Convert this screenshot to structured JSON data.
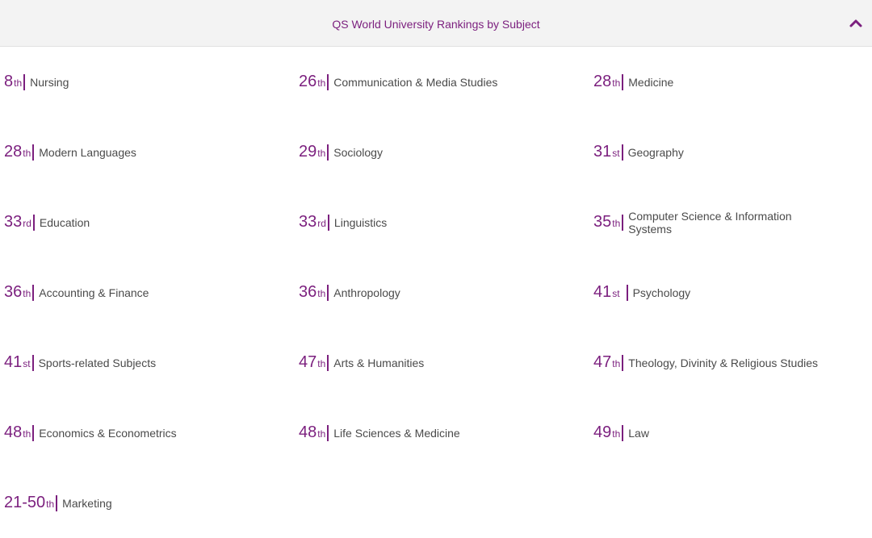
{
  "header": {
    "title": "QS World University Rankings by Subject",
    "toggle_icon": "chevron-up-icon",
    "accent_color": "#7b1f7e"
  },
  "rankings": [
    [
      {
        "rank": "8",
        "suffix": "th",
        "subject": "Nursing"
      },
      {
        "rank": "26",
        "suffix": "th",
        "subject": "Communication & Media Studies"
      },
      {
        "rank": "28",
        "suffix": "th",
        "subject": "Medicine"
      }
    ],
    [
      {
        "rank": "28",
        "suffix": "th",
        "subject": "Modern Languages"
      },
      {
        "rank": "29",
        "suffix": "th",
        "subject": "Sociology"
      },
      {
        "rank": "31",
        "suffix": "st",
        "subject": "Geography"
      }
    ],
    [
      {
        "rank": "33",
        "suffix": "rd",
        "subject": "Education"
      },
      {
        "rank": "33",
        "suffix": "rd",
        "subject": "Linguistics"
      },
      {
        "rank": "35",
        "suffix": "th",
        "subject": "Computer Science & Information Systems"
      }
    ],
    [
      {
        "rank": "36",
        "suffix": "th",
        "subject": "Accounting & Finance"
      },
      {
        "rank": "36",
        "suffix": "th",
        "subject": "Anthropology"
      },
      {
        "rank": "41",
        "suffix": "st",
        "subject": "Psychology"
      }
    ],
    [
      {
        "rank": "41",
        "suffix": "st",
        "subject": "Sports-related Subjects"
      },
      {
        "rank": "47",
        "suffix": "th",
        "subject": "Arts & Humanities"
      },
      {
        "rank": "47",
        "suffix": "th",
        "subject": "Theology, Divinity & Religious Studies"
      }
    ],
    [
      {
        "rank": "48",
        "suffix": "th",
        "subject": "Economics & Econometrics"
      },
      {
        "rank": "48",
        "suffix": "th",
        "subject": "Life Sciences & Medicine"
      },
      {
        "rank": "49",
        "suffix": "th",
        "subject": "Law"
      }
    ],
    [
      {
        "rank": "21-50",
        "suffix": "th",
        "subject": "Marketing"
      }
    ]
  ]
}
